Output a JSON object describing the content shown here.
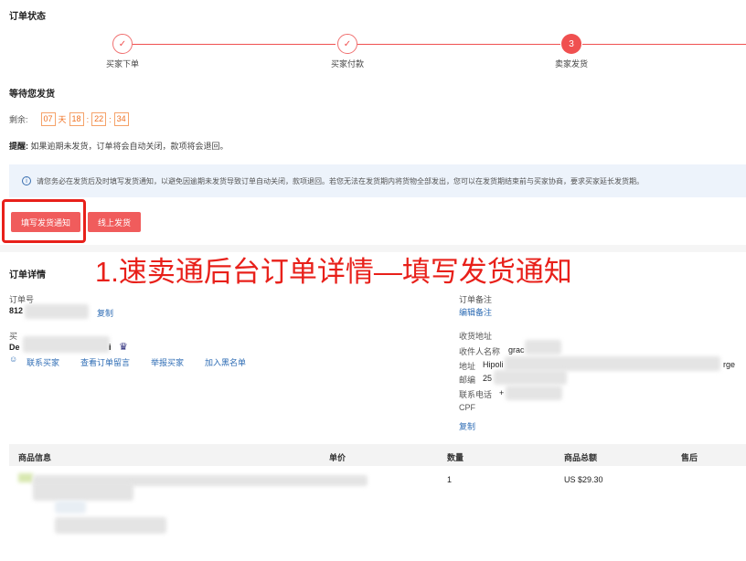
{
  "order_status": {
    "title": "订单状态",
    "steps": [
      {
        "label": "买家下单",
        "state": "done"
      },
      {
        "label": "买家付款",
        "state": "done"
      },
      {
        "label": "卖家发货",
        "state": "active",
        "number": "3"
      }
    ],
    "waiting_title": "等待您发货",
    "remaining_label": "剩余:",
    "countdown": {
      "days": "07",
      "day_unit": "天",
      "hours": "18",
      "minutes": "22",
      "seconds": "34",
      "sep": ":"
    },
    "reminder_label": "提醒:",
    "reminder_text": "如果逾期未发货，订单将会自动关闭，款项将会退回。",
    "notice_text": "请您务必在发货后及时填写发货通知，以避免因逾期未发货导致订单自动关闭，款项退回。若您无法在发货期内将货物全部发出，您可以在发货期结束前与买家协商，要求买家延长发货期。",
    "buttons": {
      "fill_notice": "填写发货通知",
      "online_ship": "线上发货"
    }
  },
  "annotation": "1.速卖通后台订单详情—填写发货通知",
  "order_detail": {
    "title": "订单详情",
    "order_no_label": "订单号",
    "order_no_prefix": "812",
    "copy": "复制",
    "buyer_label": "买",
    "buyer_prefix": "De",
    "buyer_suffix": "i",
    "buyer_links": [
      "联系买家",
      "查看订单留言",
      "举报买家",
      "加入黑名单"
    ],
    "remark_label": "订单备注",
    "remark_edit": "编辑备注",
    "address_title": "收货地址",
    "recipient_label": "收件人名称",
    "recipient_prefix": "grac",
    "address_label": "地址",
    "address_prefix": "Hipoli",
    "address_suffix": "rge",
    "zip_label": "邮编",
    "zip_prefix": "25",
    "phone_label": "联系电话",
    "phone_prefix": "+",
    "cpf_label": "CPF",
    "address_copy": "复制"
  },
  "table": {
    "headers": [
      "商品信息",
      "单价",
      "数量",
      "商品总额",
      "售后"
    ],
    "rows": [
      {
        "quantity": "1",
        "total": "US $29.30"
      }
    ]
  },
  "colors": {
    "accent": "#f05050",
    "link": "#2f6db5",
    "annotation": "#e8201a",
    "countdown": "#f07020"
  }
}
